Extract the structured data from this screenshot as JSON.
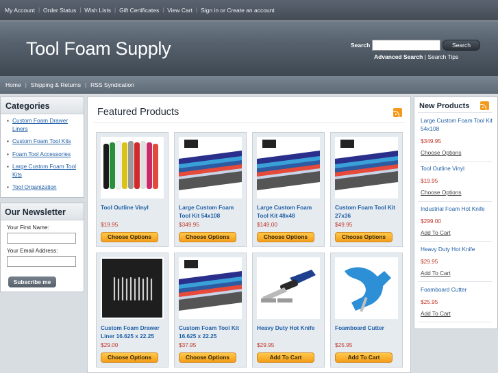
{
  "top_nav": {
    "items": [
      "My Account",
      "Order Status",
      "Wish Lists",
      "Gift Certificates",
      "View Cart"
    ],
    "sign_in": "Sign in or Create an account"
  },
  "header": {
    "logo": "Tool Foam Supply",
    "search_label": "Search",
    "search_value": "",
    "search_button": "Search",
    "advanced_search": "Advanced Search",
    "separator": "|",
    "search_tips": "Search Tips"
  },
  "sub_nav": {
    "items": [
      "Home",
      "Shipping & Returns",
      "RSS Syndication"
    ]
  },
  "categories": {
    "title": "Categories",
    "items": [
      "Custom Foam Drawer Liners",
      "Custom Foam Tool Kits",
      "Foam Tool Accessories",
      "Large Custom Foam Tool Kits",
      "Tool Organization"
    ]
  },
  "newsletter": {
    "title": "Our Newsletter",
    "first_name_label": "Your First Name:",
    "first_name_value": "",
    "email_label": "Your Email Address:",
    "email_value": "",
    "subscribe": "Subscribe me"
  },
  "featured": {
    "title": "Featured Products",
    "products": [
      {
        "name": "Tool Outline Vinyl",
        "price": "$19.95",
        "button": "Choose Options",
        "image": "vinyl-rolls"
      },
      {
        "name": "Large Custom Foam Tool Kit 54x108",
        "price": "$349.95",
        "button": "Choose Options",
        "image": "foam-sheets"
      },
      {
        "name": "Large Custom Foam Tool Kit 48x48",
        "price": "$149.00",
        "button": "Choose Options",
        "image": "foam-sheets"
      },
      {
        "name": "Custom Foam Tool Kit 27x36",
        "price": "$49.95",
        "button": "Choose Options",
        "image": "foam-sheets"
      },
      {
        "name": "Custom Foam Drawer Liner 16.625 x 22.25",
        "price": "$29.00",
        "button": "Choose Options",
        "image": "drawer-liner"
      },
      {
        "name": "Custom Foam Tool Kit 16.625 x 22.25",
        "price": "$37.95",
        "button": "Choose Options",
        "image": "foam-sheets"
      },
      {
        "name": "Heavy Duty Hot Knife",
        "price": "$29.95",
        "button": "Add To Cart",
        "image": "hot-knife"
      },
      {
        "name": "Foamboard Cutter",
        "price": "$25.95",
        "button": "Add To Cart",
        "image": "foamboard-cutter"
      }
    ]
  },
  "new_products": {
    "title": "New Products",
    "items": [
      {
        "name": "Large Custom Foam Tool Kit 54x108",
        "price": "$349.95",
        "action": "Choose Options"
      },
      {
        "name": "Tool Outline Vinyl",
        "price": "$19.95",
        "action": "Choose Options"
      },
      {
        "name": "Industrial Foam Hot Knife",
        "price": "$299.00",
        "action": "Add To Cart"
      },
      {
        "name": "Heavy Duty Hot Knife",
        "price": "$29.95",
        "action": "Add To Cart"
      },
      {
        "name": "Foamboard Cutter",
        "price": "$25.95",
        "action": "Add To Cart"
      }
    ]
  },
  "colors": {
    "link": "#1f5fa6",
    "price": "#c0392b",
    "button_orange": "#f39e1a",
    "header_dark": "#3e4852"
  }
}
